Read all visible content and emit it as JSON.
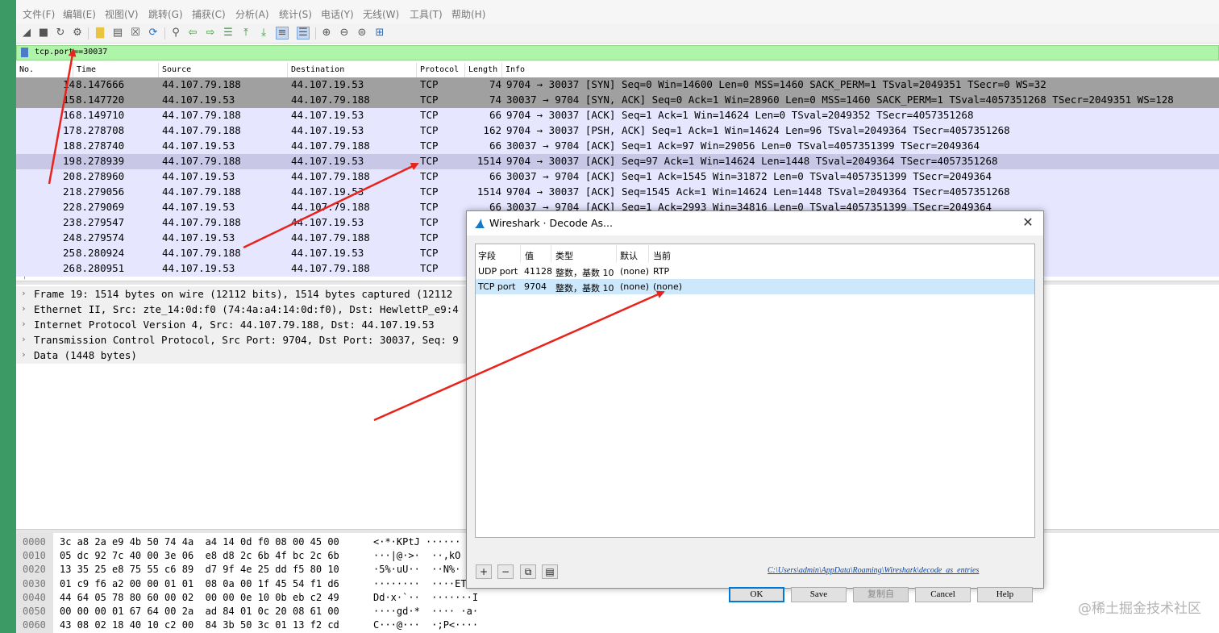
{
  "menu": [
    "文件(F)",
    "编辑(E)",
    "视图(V)",
    "跳转(G)",
    "捕获(C)",
    "分析(A)",
    "统计(S)",
    "电话(Y)",
    "无线(W)",
    "工具(T)",
    "帮助(H)"
  ],
  "filter": {
    "text": "tcp.port==30037"
  },
  "packet_list": {
    "headers": [
      "No.",
      "Time",
      "Source",
      "Destination",
      "Protocol",
      "Length",
      "Info"
    ],
    "rows": [
      {
        "no": "14",
        "time": "8.147666",
        "src": "44.107.79.188",
        "dst": "44.107.19.53",
        "proto": "TCP",
        "len": "74",
        "info": "9704 → 30037 [SYN] Seq=0 Win=14600 Len=0 MSS=1460 SACK_PERM=1 TSval=2049351 TSecr=0 WS=32",
        "color": "#a0a0a0"
      },
      {
        "no": "15",
        "time": "8.147720",
        "src": "44.107.19.53",
        "dst": "44.107.79.188",
        "proto": "TCP",
        "len": "74",
        "info": "30037 → 9704 [SYN, ACK] Seq=0 Ack=1 Win=28960 Len=0 MSS=1460 SACK_PERM=1 TSval=4057351268 TSecr=2049351 WS=128",
        "color": "#a0a0a0"
      },
      {
        "no": "16",
        "time": "8.149710",
        "src": "44.107.79.188",
        "dst": "44.107.19.53",
        "proto": "TCP",
        "len": "66",
        "info": "9704 → 30037 [ACK] Seq=1 Ack=1 Win=14624 Len=0 TSval=2049352 TSecr=4057351268",
        "color": "#e7e6ff"
      },
      {
        "no": "17",
        "time": "8.278708",
        "src": "44.107.79.188",
        "dst": "44.107.19.53",
        "proto": "TCP",
        "len": "162",
        "info": "9704 → 30037 [PSH, ACK] Seq=1 Ack=1 Win=14624 Len=96 TSval=2049364 TSecr=4057351268",
        "color": "#e7e6ff"
      },
      {
        "no": "18",
        "time": "8.278740",
        "src": "44.107.19.53",
        "dst": "44.107.79.188",
        "proto": "TCP",
        "len": "66",
        "info": "30037 → 9704 [ACK] Seq=1 Ack=97 Win=29056 Len=0 TSval=4057351399 TSecr=2049364",
        "color": "#e7e6ff"
      },
      {
        "no": "19",
        "time": "8.278939",
        "src": "44.107.79.188",
        "dst": "44.107.19.53",
        "proto": "TCP",
        "len": "1514",
        "info": "9704 → 30037 [ACK] Seq=97 Ack=1 Win=14624 Len=1448 TSval=2049364 TSecr=4057351268",
        "color": "#c8c8e6"
      },
      {
        "no": "20",
        "time": "8.278960",
        "src": "44.107.19.53",
        "dst": "44.107.79.188",
        "proto": "TCP",
        "len": "66",
        "info": "30037 → 9704 [ACK] Seq=1 Ack=1545 Win=31872 Len=0 TSval=4057351399 TSecr=2049364",
        "color": "#e7e6ff"
      },
      {
        "no": "21",
        "time": "8.279056",
        "src": "44.107.79.188",
        "dst": "44.107.19.53",
        "proto": "TCP",
        "len": "1514",
        "info": "9704 → 30037 [ACK] Seq=1545 Ack=1 Win=14624 Len=1448 TSval=2049364 TSecr=4057351268",
        "color": "#e7e6ff"
      },
      {
        "no": "22",
        "time": "8.279069",
        "src": "44.107.19.53",
        "dst": "44.107.79.188",
        "proto": "TCP",
        "len": "66",
        "info": "30037 → 9704 [ACK] Seq=1 Ack=2993 Win=34816 Len=0 TSval=4057351399 TSecr=2049364",
        "color": "#e7e6ff"
      },
      {
        "no": "23",
        "time": "8.279547",
        "src": "44.107.79.188",
        "dst": "44.107.19.53",
        "proto": "TCP",
        "len": "",
        "info": "",
        "color": "#e7e6ff"
      },
      {
        "no": "24",
        "time": "8.279574",
        "src": "44.107.19.53",
        "dst": "44.107.79.188",
        "proto": "TCP",
        "len": "",
        "info": "",
        "color": "#e7e6ff"
      },
      {
        "no": "25",
        "time": "8.280924",
        "src": "44.107.79.188",
        "dst": "44.107.19.53",
        "proto": "TCP",
        "len": "",
        "info": "",
        "color": "#e7e6ff"
      },
      {
        "no": "26",
        "time": "8.280951",
        "src": "44.107.19.53",
        "dst": "44.107.79.188",
        "proto": "TCP",
        "len": "",
        "info": "",
        "color": "#e7e6ff"
      }
    ]
  },
  "details": [
    "Frame 19: 1514 bytes on wire (12112 bits), 1514 bytes captured (12112",
    "Ethernet II, Src: zte_14:0d:f0 (74:4a:a4:14:0d:f0), Dst: HewlettP_e9:4",
    "Internet Protocol Version 4, Src: 44.107.79.188, Dst: 44.107.19.53",
    "Transmission Control Protocol, Src Port: 9704, Dst Port: 30037, Seq: 9",
    "Data (1448 bytes)"
  ],
  "bytes": [
    {
      "off": "0000",
      "hex": "3c a8 2a e9 4b 50 74 4a  a4 14 0d f0 08 00 45 00",
      "ascii": "<·*·KPtJ ······"
    },
    {
      "off": "0010",
      "hex": "05 dc 92 7c 40 00 3e 06  e8 d8 2c 6b 4f bc 2c 6b",
      "ascii": "···|@·>·  ··,kO"
    },
    {
      "off": "0020",
      "hex": "13 35 25 e8 75 55 c6 89  d7 9f 4e 25 dd f5 80 10",
      "ascii": "·5%·uU··  ··N%·"
    },
    {
      "off": "0030",
      "hex": "01 c9 f6 a2 00 00 01 01  08 0a 00 1f 45 54 f1 d6",
      "ascii": "········  ····ET"
    },
    {
      "off": "0040",
      "hex": "44 64 05 78 80 60 00 02  00 00 0e 10 0b eb c2 49",
      "ascii": "Dd·x·`··  ·······I"
    },
    {
      "off": "0050",
      "hex": "00 00 00 01 67 64 00 2a  ad 84 01 0c 20 08 61 00",
      "ascii": "····gd·*  ···· ·a·"
    },
    {
      "off": "0060",
      "hex": "43 08 02 18 40 10 c2 00  84 3b 50 3c 01 13 f2 cd",
      "ascii": "C···@···  ·;P<····"
    }
  ],
  "dialog": {
    "title": "Wireshark · Decode As...",
    "columns": [
      "字段",
      "值",
      "类型",
      "默认",
      "当前"
    ],
    "rows": [
      {
        "field": "UDP port",
        "value": "41128",
        "type": "整数，基数 10",
        "default": "(none)",
        "current": "RTP"
      },
      {
        "field": "TCP port",
        "value": "9704",
        "type": "整数，基数 10",
        "default": "(none)",
        "current": "(none)"
      }
    ],
    "path": "C:\\Users\\admin\\AppData\\Roaming\\Wireshark\\decode_as_entries",
    "buttons": {
      "ok": "OK",
      "save": "Save",
      "copy": "复制自",
      "cancel": "Cancel",
      "help": "Help"
    },
    "small_buttons": {
      "add": "+",
      "remove": "−"
    }
  },
  "watermark": "@稀土掘金技术社区",
  "colors": {
    "filter_bg": "#aff5a9",
    "annotation": "#e8231c",
    "selected_row": "#c8c8e6",
    "syn_row": "#a0a0a0",
    "tcp_row": "#e7e6ff"
  }
}
